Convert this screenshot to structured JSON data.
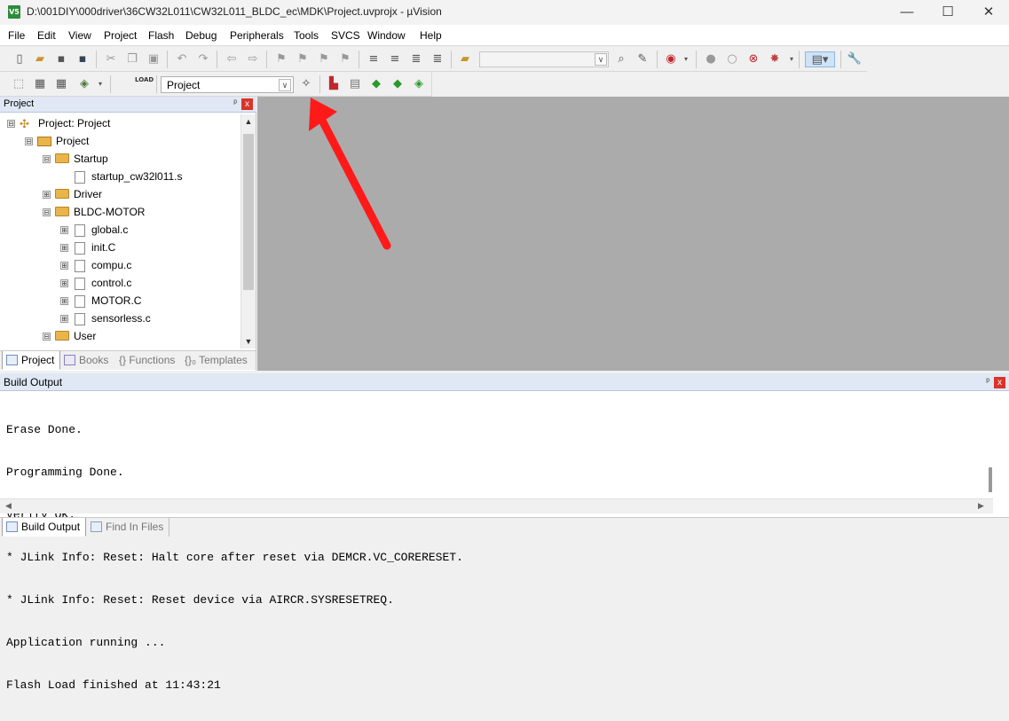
{
  "window": {
    "app_icon": "V5",
    "title": "D:\\001DIY\\000driver\\36CW32L011\\CW32L011_BLDC_ec\\MDK\\Project.uvprojx - µVision",
    "minimize": "—",
    "maximize": "☐",
    "close": "✕"
  },
  "menu": [
    "File",
    "Edit",
    "View",
    "Project",
    "Flash",
    "Debug",
    "Peripherals",
    "Tools",
    "SVCS",
    "Window",
    "Help"
  ],
  "toolbar2": {
    "load_label": "LOAD",
    "target_select": "Project",
    "combo_arrow": "∨"
  },
  "project_panel": {
    "title": "Project",
    "pin": "ᵖ",
    "close": "x",
    "tree": [
      {
        "expander": "⊟",
        "label": "Project: Project"
      },
      {
        "expander": "⊟",
        "label": "Project"
      },
      {
        "expander": "⊟",
        "label": "Startup"
      },
      {
        "expander": "",
        "label": "startup_cw32l011.s"
      },
      {
        "expander": "⊞",
        "label": "Driver"
      },
      {
        "expander": "⊟",
        "label": "BLDC-MOTOR"
      },
      {
        "expander": "⊞",
        "label": "global.c"
      },
      {
        "expander": "⊞",
        "label": "init.C"
      },
      {
        "expander": "⊞",
        "label": "compu.c"
      },
      {
        "expander": "⊞",
        "label": "control.c"
      },
      {
        "expander": "⊞",
        "label": "MOTOR.C"
      },
      {
        "expander": "⊞",
        "label": "sensorless.c"
      },
      {
        "expander": "⊟",
        "label": "User"
      }
    ],
    "tabs": [
      "Project",
      "Books",
      "{} Functions",
      "{}₀ Templates"
    ]
  },
  "build_output": {
    "title": "Build Output",
    "pin": "ᵖ",
    "close": "x",
    "lines": [
      "Erase Done.",
      "Programming Done.",
      "Verify OK.",
      "* JLink Info: Reset: Halt core after reset via DEMCR.VC_CORERESET.",
      "* JLink Info: Reset: Reset device via AIRCR.SYSRESETREQ.",
      "Application running ...",
      "Flash Load finished at 11:43:21"
    ],
    "tabs": [
      "Build Output",
      "Find In Files"
    ]
  },
  "colors": {
    "editor_bg": "#ababab",
    "panel_header": "#dfe8f4",
    "annotation_arrow": "#ff1a1a"
  }
}
